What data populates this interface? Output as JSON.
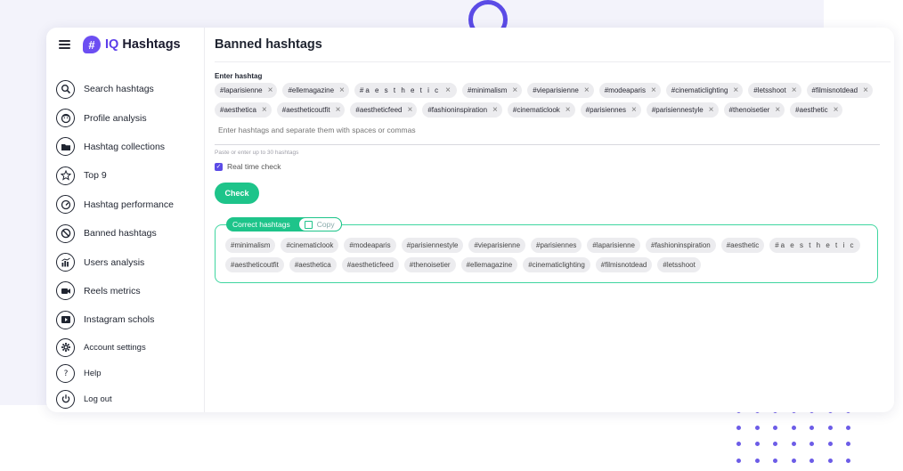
{
  "app": {
    "brand_prefix": "IQ",
    "brand_name": "Hashtags",
    "logo_glyph": "#"
  },
  "nav": [
    {
      "label": "Search hashtags",
      "icon": "search-icon"
    },
    {
      "label": "Profile analysis",
      "icon": "face-icon"
    },
    {
      "label": "Hashtag collections",
      "icon": "folder-icon"
    },
    {
      "label": "Top 9",
      "icon": "star-icon"
    },
    {
      "label": "Hashtag performance",
      "icon": "gauge-icon"
    },
    {
      "label": "Banned hashtags",
      "icon": "ban-icon"
    },
    {
      "label": "Users analysis",
      "icon": "bar-chart-icon"
    },
    {
      "label": "Reels metrics",
      "icon": "video-icon"
    },
    {
      "label": "Instagram schols",
      "icon": "play-icon"
    }
  ],
  "nav_bottom": [
    {
      "label": "Account settings",
      "icon": "gear-icon"
    },
    {
      "label": "Help",
      "icon": "question-icon"
    },
    {
      "label": "Log out",
      "icon": "power-icon"
    }
  ],
  "main": {
    "title": "Banned hashtags",
    "input_label": "Enter hashtag",
    "entered_tags": [
      "#laparisienne",
      "#ellemagazine",
      "#a e s t h e t i c",
      "#minimalism",
      "#vieparisienne",
      "#modeaparis",
      "#cinematiclighting",
      "#letsshoot",
      "#filmisnotdead",
      "#aesthetica",
      "#aestheticoutfit",
      "#aestheticfeed",
      "#fashioninspiration",
      "#cinematiclook",
      "#parisiennes",
      "#parisiennestyle",
      "#thenoisetier",
      "#aesthetic"
    ],
    "input_placeholder": "Enter hashtags and separate them with spaces or commas",
    "hint": "Paste or enter up to 30 hashtags",
    "realtime_label": "Real time check",
    "realtime_checked": true,
    "check_label": "Check",
    "correct_label": "Correct hashtags",
    "copy_label": "Copy",
    "correct_tags": [
      "#minimalism",
      "#cinematiclook",
      "#modeaparis",
      "#parisiennestyle",
      "#vieparisienne",
      "#parisiennes",
      "#laparisienne",
      "#fashioninspiration",
      "#aesthetic",
      "#a e s t h e t i c",
      "#aestheticoutfit",
      "#aesthetica",
      "#aestheticfeed",
      "#thenoisetier",
      "#ellemagazine",
      "#cinematiclighting",
      "#filmisnotdead",
      "#letsshoot"
    ]
  },
  "colors": {
    "accent": "#5b4be6",
    "success": "#1ec48a",
    "deco_yellow": "#f8cf54"
  }
}
